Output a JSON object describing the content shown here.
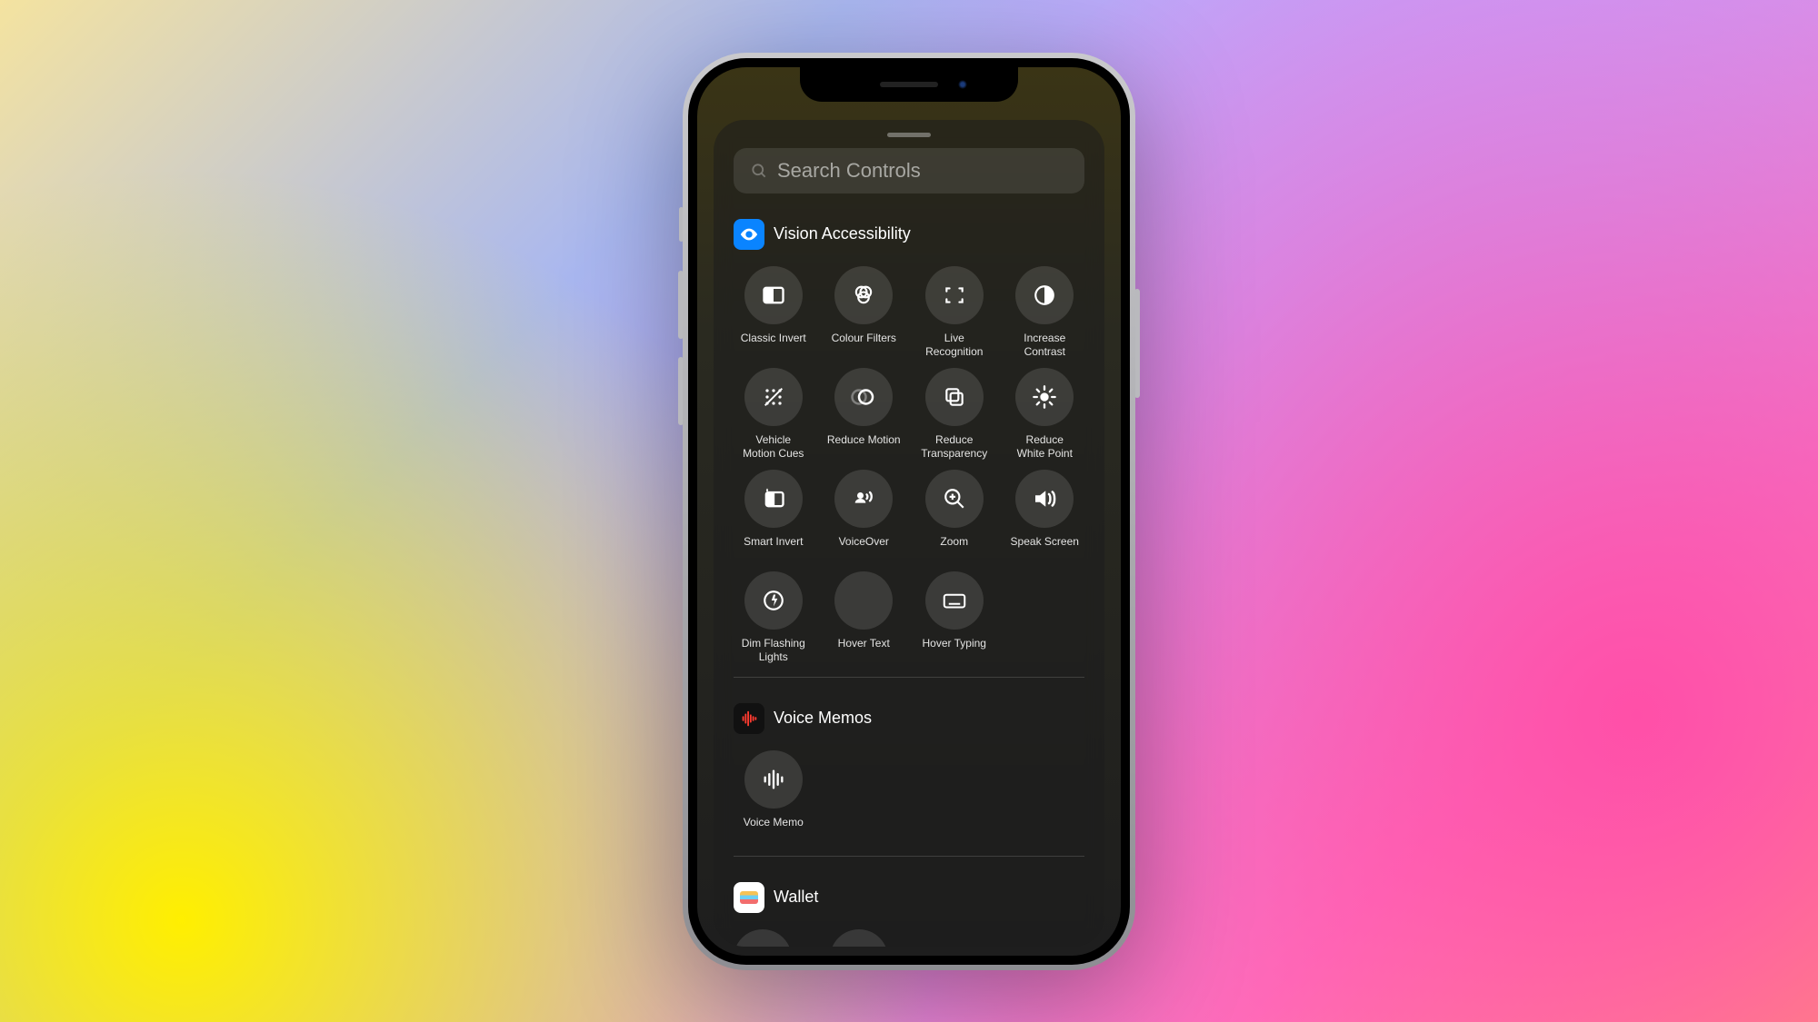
{
  "search": {
    "placeholder": "Search Controls"
  },
  "sections": {
    "vision": {
      "title": "Vision Accessibility",
      "controls": [
        {
          "id": "classic-invert",
          "label": "Classic Invert"
        },
        {
          "id": "colour-filters",
          "label": "Colour Filters"
        },
        {
          "id": "live-recognition",
          "label": "Live\nRecognition"
        },
        {
          "id": "increase-contrast",
          "label": "Increase\nContrast"
        },
        {
          "id": "vehicle-motion-cues",
          "label": "Vehicle\nMotion Cues"
        },
        {
          "id": "reduce-motion",
          "label": "Reduce Motion"
        },
        {
          "id": "reduce-transparency",
          "label": "Reduce\nTransparency"
        },
        {
          "id": "reduce-white-point",
          "label": "Reduce\nWhite Point"
        },
        {
          "id": "smart-invert",
          "label": "Smart Invert"
        },
        {
          "id": "voiceover",
          "label": "VoiceOver"
        },
        {
          "id": "zoom",
          "label": "Zoom"
        },
        {
          "id": "speak-screen",
          "label": "Speak Screen"
        },
        {
          "id": "dim-flashing",
          "label": "Dim Flashing\nLights"
        },
        {
          "id": "hover-text",
          "label": "Hover Text"
        },
        {
          "id": "hover-typing",
          "label": "Hover Typing"
        }
      ]
    },
    "memos": {
      "title": "Voice Memos",
      "controls": [
        {
          "id": "voice-memo",
          "label": "Voice Memo"
        }
      ]
    },
    "wallet": {
      "title": "Wallet"
    }
  }
}
